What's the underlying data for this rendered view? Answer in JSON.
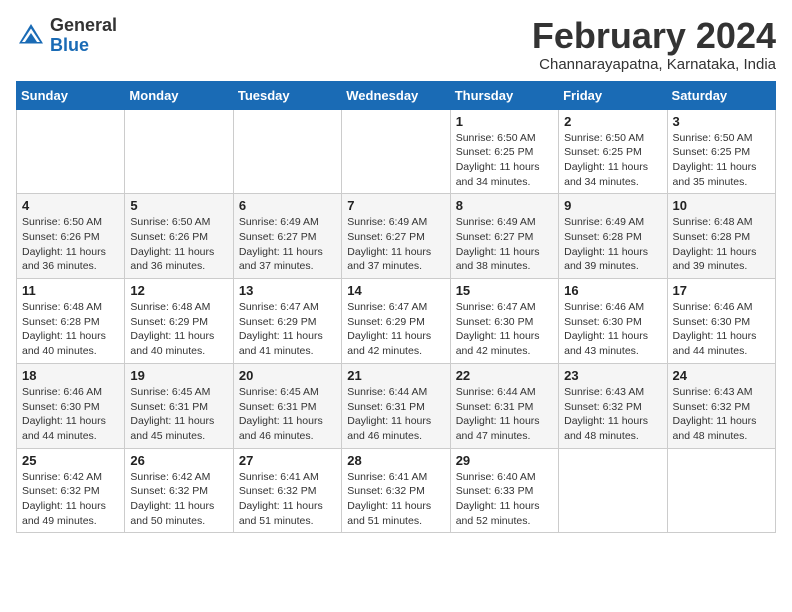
{
  "logo": {
    "general": "General",
    "blue": "Blue"
  },
  "title": "February 2024",
  "location": "Channarayapatna, Karnataka, India",
  "headers": [
    "Sunday",
    "Monday",
    "Tuesday",
    "Wednesday",
    "Thursday",
    "Friday",
    "Saturday"
  ],
  "weeks": [
    [
      {
        "day": "",
        "info": ""
      },
      {
        "day": "",
        "info": ""
      },
      {
        "day": "",
        "info": ""
      },
      {
        "day": "",
        "info": ""
      },
      {
        "day": "1",
        "info": "Sunrise: 6:50 AM\nSunset: 6:25 PM\nDaylight: 11 hours\nand 34 minutes."
      },
      {
        "day": "2",
        "info": "Sunrise: 6:50 AM\nSunset: 6:25 PM\nDaylight: 11 hours\nand 34 minutes."
      },
      {
        "day": "3",
        "info": "Sunrise: 6:50 AM\nSunset: 6:25 PM\nDaylight: 11 hours\nand 35 minutes."
      }
    ],
    [
      {
        "day": "4",
        "info": "Sunrise: 6:50 AM\nSunset: 6:26 PM\nDaylight: 11 hours\nand 36 minutes."
      },
      {
        "day": "5",
        "info": "Sunrise: 6:50 AM\nSunset: 6:26 PM\nDaylight: 11 hours\nand 36 minutes."
      },
      {
        "day": "6",
        "info": "Sunrise: 6:49 AM\nSunset: 6:27 PM\nDaylight: 11 hours\nand 37 minutes."
      },
      {
        "day": "7",
        "info": "Sunrise: 6:49 AM\nSunset: 6:27 PM\nDaylight: 11 hours\nand 37 minutes."
      },
      {
        "day": "8",
        "info": "Sunrise: 6:49 AM\nSunset: 6:27 PM\nDaylight: 11 hours\nand 38 minutes."
      },
      {
        "day": "9",
        "info": "Sunrise: 6:49 AM\nSunset: 6:28 PM\nDaylight: 11 hours\nand 39 minutes."
      },
      {
        "day": "10",
        "info": "Sunrise: 6:48 AM\nSunset: 6:28 PM\nDaylight: 11 hours\nand 39 minutes."
      }
    ],
    [
      {
        "day": "11",
        "info": "Sunrise: 6:48 AM\nSunset: 6:28 PM\nDaylight: 11 hours\nand 40 minutes."
      },
      {
        "day": "12",
        "info": "Sunrise: 6:48 AM\nSunset: 6:29 PM\nDaylight: 11 hours\nand 40 minutes."
      },
      {
        "day": "13",
        "info": "Sunrise: 6:47 AM\nSunset: 6:29 PM\nDaylight: 11 hours\nand 41 minutes."
      },
      {
        "day": "14",
        "info": "Sunrise: 6:47 AM\nSunset: 6:29 PM\nDaylight: 11 hours\nand 42 minutes."
      },
      {
        "day": "15",
        "info": "Sunrise: 6:47 AM\nSunset: 6:30 PM\nDaylight: 11 hours\nand 42 minutes."
      },
      {
        "day": "16",
        "info": "Sunrise: 6:46 AM\nSunset: 6:30 PM\nDaylight: 11 hours\nand 43 minutes."
      },
      {
        "day": "17",
        "info": "Sunrise: 6:46 AM\nSunset: 6:30 PM\nDaylight: 11 hours\nand 44 minutes."
      }
    ],
    [
      {
        "day": "18",
        "info": "Sunrise: 6:46 AM\nSunset: 6:30 PM\nDaylight: 11 hours\nand 44 minutes."
      },
      {
        "day": "19",
        "info": "Sunrise: 6:45 AM\nSunset: 6:31 PM\nDaylight: 11 hours\nand 45 minutes."
      },
      {
        "day": "20",
        "info": "Sunrise: 6:45 AM\nSunset: 6:31 PM\nDaylight: 11 hours\nand 46 minutes."
      },
      {
        "day": "21",
        "info": "Sunrise: 6:44 AM\nSunset: 6:31 PM\nDaylight: 11 hours\nand 46 minutes."
      },
      {
        "day": "22",
        "info": "Sunrise: 6:44 AM\nSunset: 6:31 PM\nDaylight: 11 hours\nand 47 minutes."
      },
      {
        "day": "23",
        "info": "Sunrise: 6:43 AM\nSunset: 6:32 PM\nDaylight: 11 hours\nand 48 minutes."
      },
      {
        "day": "24",
        "info": "Sunrise: 6:43 AM\nSunset: 6:32 PM\nDaylight: 11 hours\nand 48 minutes."
      }
    ],
    [
      {
        "day": "25",
        "info": "Sunrise: 6:42 AM\nSunset: 6:32 PM\nDaylight: 11 hours\nand 49 minutes."
      },
      {
        "day": "26",
        "info": "Sunrise: 6:42 AM\nSunset: 6:32 PM\nDaylight: 11 hours\nand 50 minutes."
      },
      {
        "day": "27",
        "info": "Sunrise: 6:41 AM\nSunset: 6:32 PM\nDaylight: 11 hours\nand 51 minutes."
      },
      {
        "day": "28",
        "info": "Sunrise: 6:41 AM\nSunset: 6:32 PM\nDaylight: 11 hours\nand 51 minutes."
      },
      {
        "day": "29",
        "info": "Sunrise: 6:40 AM\nSunset: 6:33 PM\nDaylight: 11 hours\nand 52 minutes."
      },
      {
        "day": "",
        "info": ""
      },
      {
        "day": "",
        "info": ""
      }
    ]
  ]
}
